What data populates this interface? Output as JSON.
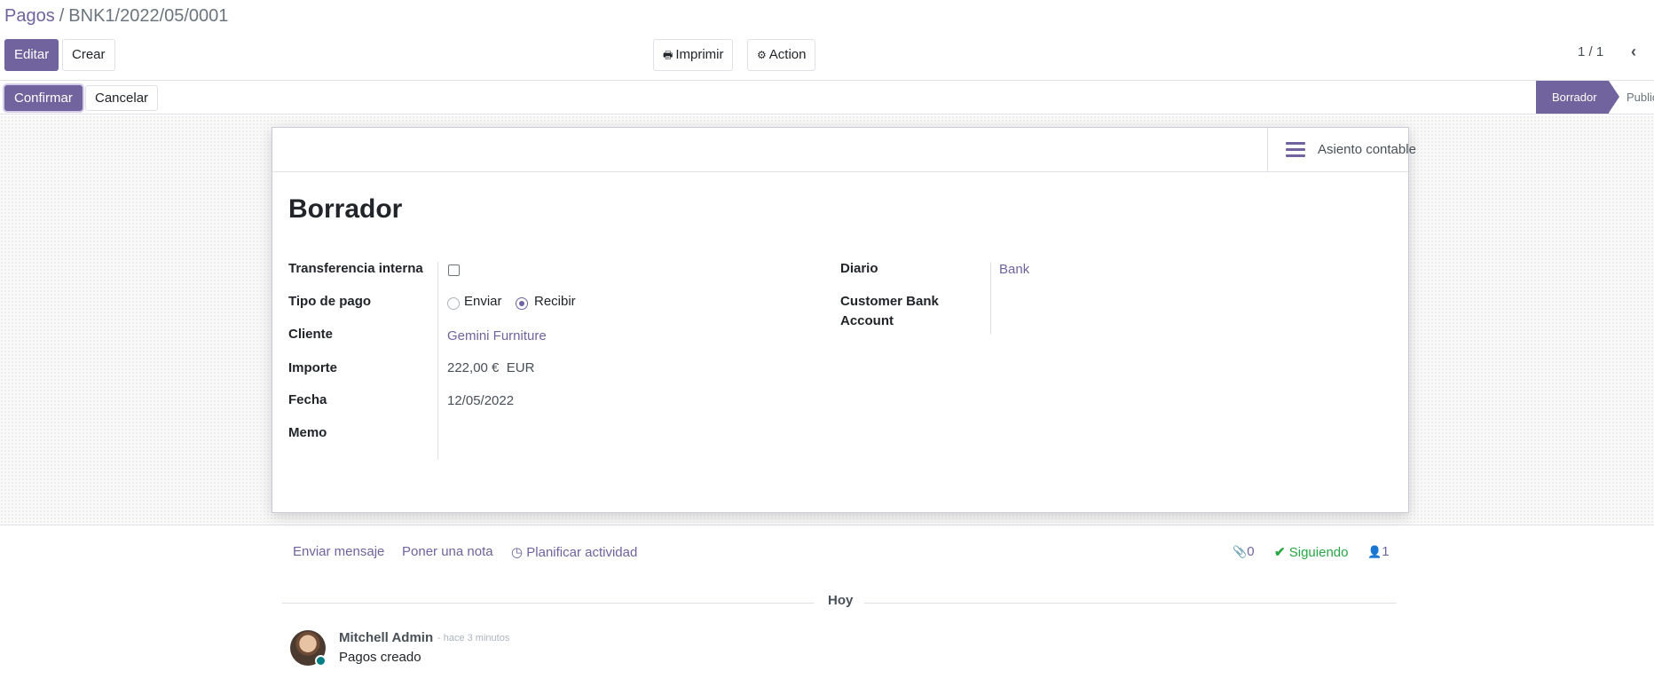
{
  "breadcrumb": {
    "parent": "Pagos",
    "separator": "/",
    "current": "BNK1/2022/05/0001"
  },
  "toolbar": {
    "edit_label": "Editar",
    "create_label": "Crear",
    "print_label": "Imprimir",
    "action_label": "Action"
  },
  "pager": {
    "value": "1 / 1"
  },
  "statusbar": {
    "confirm_label": "Confirmar",
    "cancel_label": "Cancelar",
    "stage_active": "Borrador",
    "stage_next": "Publicado"
  },
  "smart_button": {
    "label": "Asiento contable",
    "icon": "bars-icon"
  },
  "form": {
    "title": "Borrador",
    "fields": {
      "internal_transfer": {
        "label": "Transferencia interna",
        "checked": false
      },
      "payment_type": {
        "label": "Tipo de pago",
        "options": [
          "Enviar",
          "Recibir"
        ],
        "selected": "Recibir"
      },
      "customer": {
        "label": "Cliente",
        "value": "Gemini Furniture"
      },
      "amount": {
        "label": "Importe",
        "value": "222,00 €",
        "currency": "EUR"
      },
      "date": {
        "label": "Fecha",
        "value": "12/05/2022"
      },
      "memo": {
        "label": "Memo",
        "value": ""
      },
      "journal": {
        "label": "Diario",
        "value": "Bank"
      },
      "bank_account": {
        "label_line1": "Customer Bank",
        "label_line2": "Account",
        "value": ""
      }
    }
  },
  "chatter": {
    "send_message": "Enviar mensaje",
    "log_note": "Poner una nota",
    "schedule_activity": "Planificar actividad",
    "attachments_count": "0",
    "following_label": "Siguiendo",
    "followers_count": "1",
    "date_separator": "Hoy",
    "message": {
      "author": "Mitchell Admin",
      "date": "- hace 3 minutos",
      "body": "Pagos creado"
    }
  },
  "colors": {
    "brand": "#71639e",
    "following": "#28a745"
  }
}
